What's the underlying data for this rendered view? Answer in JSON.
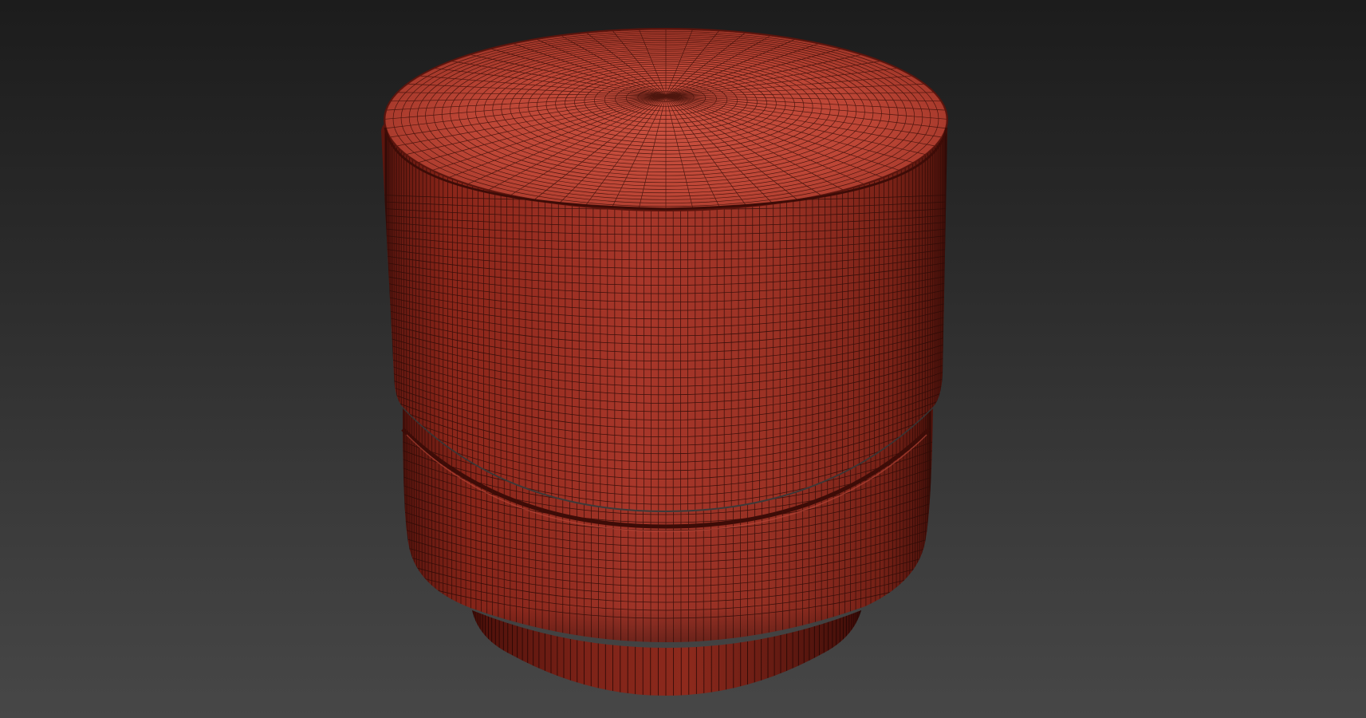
{
  "viewport": {
    "background_top": "#1c1c1c",
    "background_bottom": "#474747"
  },
  "model": {
    "name": "pouf-ottoman",
    "display_mode": "shaded-wireframe",
    "base_color": "#b23a2c",
    "wire_color": "#2a0b07"
  }
}
